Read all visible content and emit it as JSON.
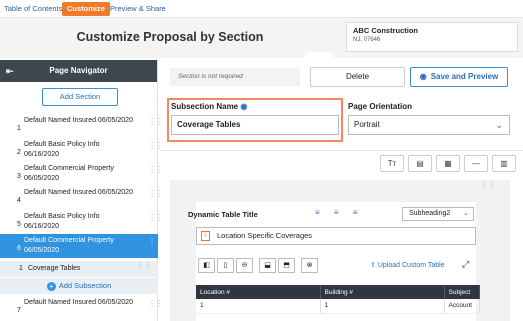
{
  "topnav": {
    "tabs": [
      {
        "label": "Table of Contents"
      },
      {
        "label": "Customize"
      },
      {
        "label": "Preview & Share"
      }
    ]
  },
  "header": {
    "title": "Customize Proposal by Section",
    "company_name": "ABC Construction",
    "company_address": "NJ, 07646"
  },
  "sidebar": {
    "title": "Page Navigator",
    "add_section_label": "Add Section",
    "items": [
      {
        "num": "1",
        "label": "Default Named Insured 06/05/2020"
      },
      {
        "num": "2",
        "label": "Default Basic Policy Info 06/16/2020"
      },
      {
        "num": "3",
        "label": "Default Commercial Property 06/05/2020"
      },
      {
        "num": "4",
        "label": "Default Named Insured 06/05/2020"
      },
      {
        "num": "5",
        "label": "Default Basic Policy Info 06/16/2020"
      },
      {
        "num": "6",
        "label": "Default Commercial Property 06/05/2020"
      },
      {
        "num": "7",
        "label": "Default Named Insured 06/05/2020"
      }
    ],
    "active_index": 5,
    "subsection": {
      "num": "1",
      "label": "Coverage Tables"
    },
    "add_subsection_label": "Add Subsection"
  },
  "main": {
    "note": "Section is not required",
    "delete_label": "Delete",
    "save_preview_label": "Save and Preview",
    "subsection_name_label": "Subsection Name",
    "subsection_name_value": "Coverage Tables",
    "orientation_label": "Page Orientation",
    "orientation_value": "Portrait"
  },
  "table_panel": {
    "title_label": "Dynamic Table Title",
    "heading_value": "Subheading2",
    "title_value": "Location Specific Coverages",
    "upload_label": "Upload Custom Table",
    "columns": [
      "Location #",
      "Building #",
      "Subject"
    ],
    "rows": [
      [
        "1",
        "1",
        "Account"
      ]
    ]
  },
  "colors": {
    "accent": "#f07a2a",
    "primary": "#2f93e0",
    "dark": "#3e4650"
  }
}
